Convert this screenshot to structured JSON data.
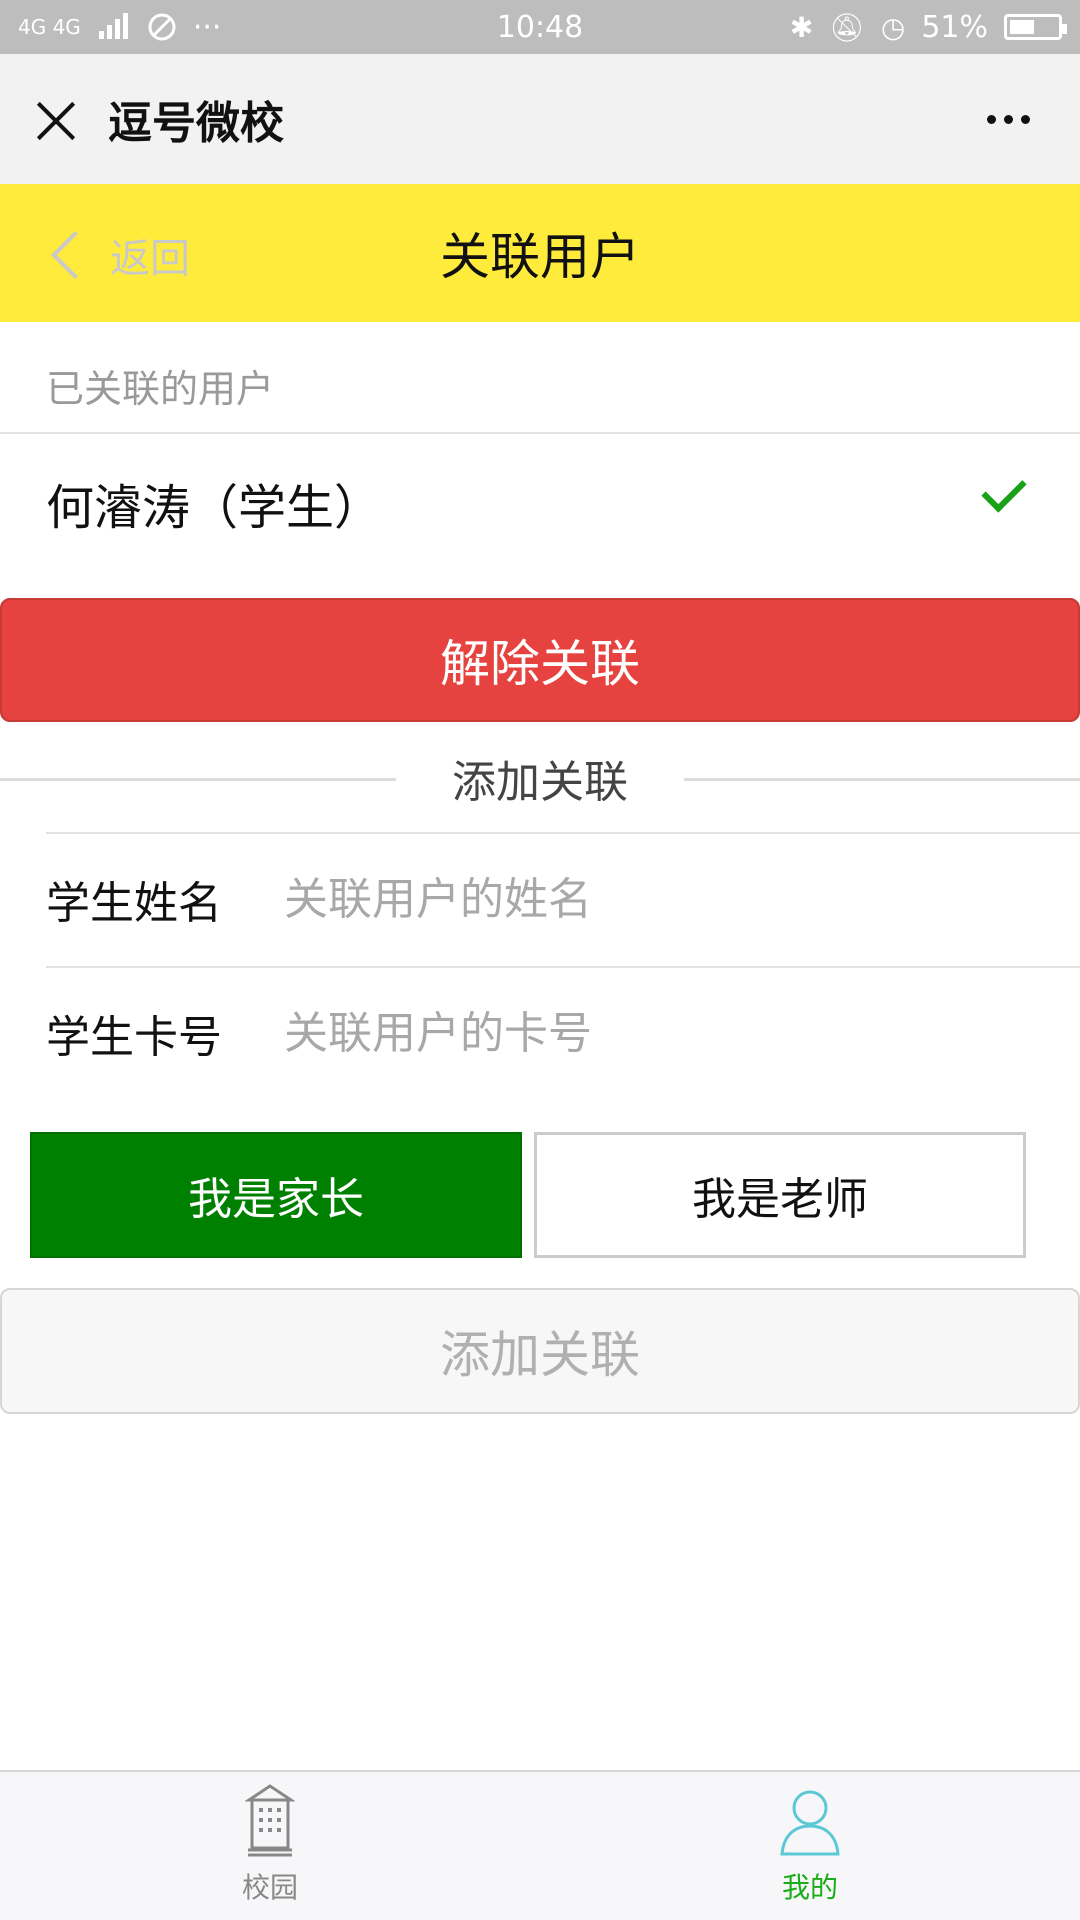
{
  "status_bar": {
    "network": "4G 4G",
    "time": "10:48",
    "battery": "51%",
    "battery_level": 0.51
  },
  "title_bar": {
    "title": "逗号微校"
  },
  "header": {
    "back_label": "返回",
    "title": "关联用户"
  },
  "linked_section": {
    "label": "已关联的用户",
    "user": "何濬涛（学生）",
    "unlink_button": "解除关联"
  },
  "add_section": {
    "heading": "添加关联",
    "name_label": "学生姓名",
    "name_placeholder": "关联用户的姓名",
    "name_value": "",
    "card_label": "学生卡号",
    "card_placeholder": "关联用户的卡号",
    "card_value": "",
    "role_parent": "我是家长",
    "role_teacher": "我是老师",
    "selected_role": "我是家长",
    "add_button": "添加关联"
  },
  "tabs": [
    {
      "label": "校园",
      "icon": "campus-building-icon",
      "active": false
    },
    {
      "label": "我的",
      "icon": "user-icon",
      "active": true
    }
  ],
  "colors": {
    "header_bg": "#ffeb3b",
    "danger": "#e64340",
    "selected_role": "#008000",
    "active_tab": "#1aad19",
    "check": "#19a219"
  }
}
